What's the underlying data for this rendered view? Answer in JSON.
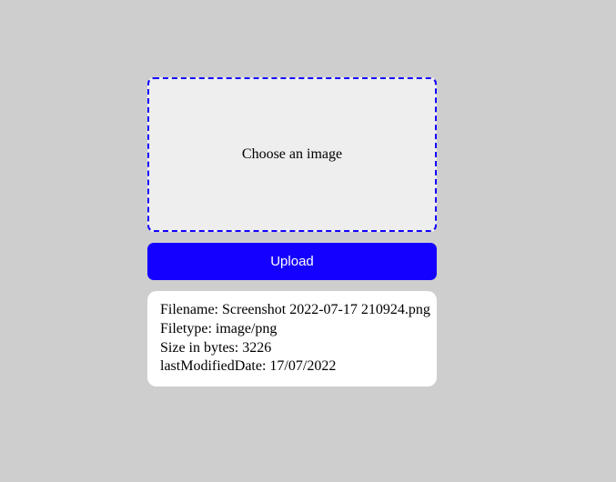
{
  "dropzone": {
    "label": "Choose an image"
  },
  "upload": {
    "label": "Upload"
  },
  "fileinfo": {
    "filename_label": "Filename: ",
    "filename": "Screenshot 2022-07-17 210924.png",
    "filetype_label": "Filetype: ",
    "filetype": "image/png",
    "size_label": "Size in bytes: ",
    "size": "3226",
    "modified_label": "lastModifiedDate: ",
    "modified": "17/07/2022"
  }
}
